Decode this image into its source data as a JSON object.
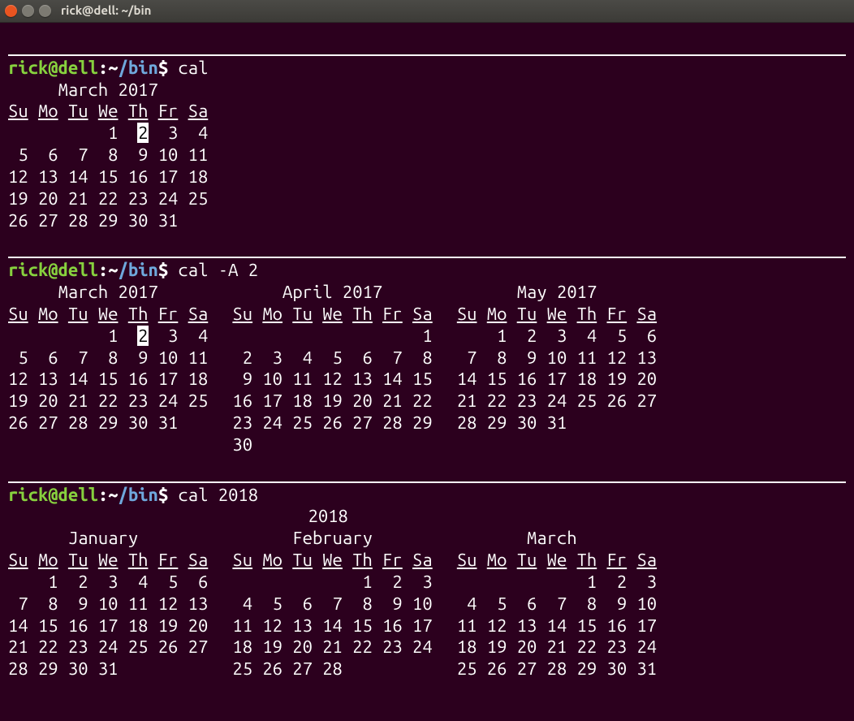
{
  "window": {
    "title": "rick@dell: ~/bin"
  },
  "prompt": {
    "user": "rick",
    "at": "@",
    "host": "dell",
    "colon": ":",
    "tilde": "~",
    "path": "/bin",
    "symbol": "$"
  },
  "day_header": [
    "Su",
    "Mo",
    "Tu",
    "We",
    "Th",
    "Fr",
    "Sa"
  ],
  "sections": [
    {
      "command": "cal",
      "months": [
        {
          "title": "March 2017",
          "today": 2,
          "weeks": [
            [
              null,
              null,
              null,
              1,
              2,
              3,
              4
            ],
            [
              5,
              6,
              7,
              8,
              9,
              10,
              11
            ],
            [
              12,
              13,
              14,
              15,
              16,
              17,
              18
            ],
            [
              19,
              20,
              21,
              22,
              23,
              24,
              25
            ],
            [
              26,
              27,
              28,
              29,
              30,
              31,
              null
            ]
          ]
        }
      ]
    },
    {
      "command": "cal -A 2",
      "months": [
        {
          "title": "March 2017",
          "today": 2,
          "weeks": [
            [
              null,
              null,
              null,
              1,
              2,
              3,
              4
            ],
            [
              5,
              6,
              7,
              8,
              9,
              10,
              11
            ],
            [
              12,
              13,
              14,
              15,
              16,
              17,
              18
            ],
            [
              19,
              20,
              21,
              22,
              23,
              24,
              25
            ],
            [
              26,
              27,
              28,
              29,
              30,
              31,
              null
            ],
            [
              null,
              null,
              null,
              null,
              null,
              null,
              null
            ]
          ]
        },
        {
          "title": "April 2017",
          "today": null,
          "weeks": [
            [
              null,
              null,
              null,
              null,
              null,
              null,
              1
            ],
            [
              2,
              3,
              4,
              5,
              6,
              7,
              8
            ],
            [
              9,
              10,
              11,
              12,
              13,
              14,
              15
            ],
            [
              16,
              17,
              18,
              19,
              20,
              21,
              22
            ],
            [
              23,
              24,
              25,
              26,
              27,
              28,
              29
            ],
            [
              30,
              null,
              null,
              null,
              null,
              null,
              null
            ]
          ]
        },
        {
          "title": "May 2017",
          "today": null,
          "weeks": [
            [
              null,
              1,
              2,
              3,
              4,
              5,
              6
            ],
            [
              7,
              8,
              9,
              10,
              11,
              12,
              13
            ],
            [
              14,
              15,
              16,
              17,
              18,
              19,
              20
            ],
            [
              21,
              22,
              23,
              24,
              25,
              26,
              27
            ],
            [
              28,
              29,
              30,
              31,
              null,
              null,
              null
            ],
            [
              null,
              null,
              null,
              null,
              null,
              null,
              null
            ]
          ]
        }
      ]
    },
    {
      "command": "cal 2018",
      "year_title": "2018",
      "months": [
        {
          "title": "January",
          "today": null,
          "weeks": [
            [
              null,
              1,
              2,
              3,
              4,
              5,
              6
            ],
            [
              7,
              8,
              9,
              10,
              11,
              12,
              13
            ],
            [
              14,
              15,
              16,
              17,
              18,
              19,
              20
            ],
            [
              21,
              22,
              23,
              24,
              25,
              26,
              27
            ],
            [
              28,
              29,
              30,
              31,
              null,
              null,
              null
            ]
          ]
        },
        {
          "title": "February",
          "today": null,
          "weeks": [
            [
              null,
              null,
              null,
              null,
              1,
              2,
              3
            ],
            [
              4,
              5,
              6,
              7,
              8,
              9,
              10
            ],
            [
              11,
              12,
              13,
              14,
              15,
              16,
              17
            ],
            [
              18,
              19,
              20,
              21,
              22,
              23,
              24
            ],
            [
              25,
              26,
              27,
              28,
              null,
              null,
              null
            ]
          ]
        },
        {
          "title": "March",
          "today": null,
          "weeks": [
            [
              null,
              null,
              null,
              null,
              1,
              2,
              3
            ],
            [
              4,
              5,
              6,
              7,
              8,
              9,
              10
            ],
            [
              11,
              12,
              13,
              14,
              15,
              16,
              17
            ],
            [
              18,
              19,
              20,
              21,
              22,
              23,
              24
            ],
            [
              25,
              26,
              27,
              28,
              29,
              30,
              31
            ]
          ]
        }
      ]
    }
  ]
}
